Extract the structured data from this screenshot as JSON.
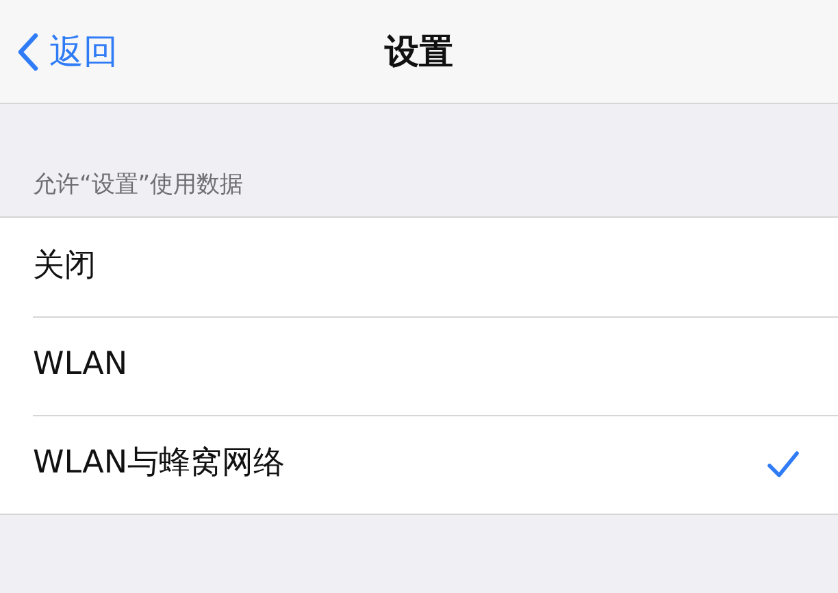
{
  "nav_bar": {
    "back_label": "返回",
    "title": "设置"
  },
  "section": {
    "header": "允许“设置”使用数据",
    "options": [
      {
        "label": "关闭",
        "selected": false
      },
      {
        "label": "WLAN",
        "selected": false
      },
      {
        "label": "WLAN与蜂窝网络",
        "selected": true
      }
    ]
  }
}
